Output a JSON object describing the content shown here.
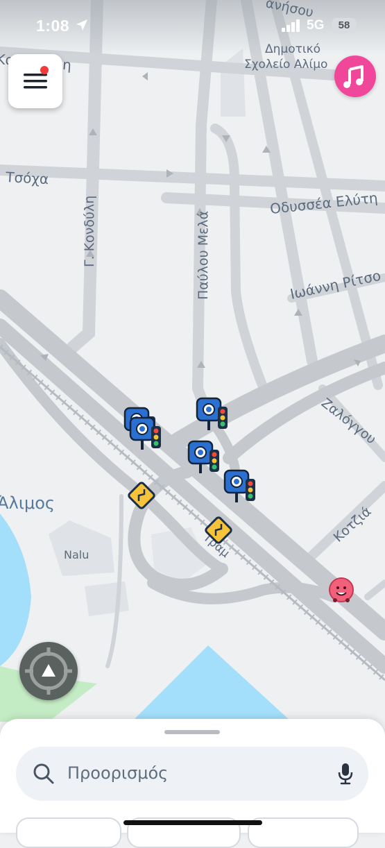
{
  "status_bar": {
    "time": "1:08",
    "network": "5G",
    "battery": "58",
    "location_icon": "location-arrow-icon",
    "signal_icon": "cellular-signal-icon"
  },
  "map": {
    "street_labels": {
      "tsocha": "Τσόχα",
      "kondyli": "Γ. Κονδύλη",
      "pavlou_mela": "Παύλου Μελά",
      "odyssea_elyti": "Οδυσσέα Ελύτη",
      "ioanni_ritsou": "Ιωάννη Ρίτσο",
      "zalongou": "Ζαλόγγου",
      "kotsia": "Κοτζιά",
      "top_left": "Κο",
      "top_left_b": "λη",
      "top_right": "ανήσου",
      "rail": "Τραμ"
    },
    "place_labels": {
      "school_line1": "Δημοτικό",
      "school_line2": "Σχολείο Αλίμο",
      "alimos": "Άλιμος",
      "nalu": "Nalu"
    },
    "markers": [
      {
        "type": "speed-camera-traffic-light",
        "icon": "speed-camera-icon"
      },
      {
        "type": "speed-camera-traffic-light",
        "icon": "speed-camera-icon"
      },
      {
        "type": "speed-camera-traffic-light",
        "icon": "speed-camera-icon"
      },
      {
        "type": "speed-camera-traffic-light",
        "icon": "speed-camera-icon"
      },
      {
        "type": "speed-camera-traffic-light",
        "icon": "speed-camera-icon"
      },
      {
        "type": "winding-road-sign",
        "icon": "winding-road-icon"
      },
      {
        "type": "winding-road-sign",
        "icon": "winding-road-icon"
      },
      {
        "type": "wazer",
        "icon": "wazer-icon"
      }
    ],
    "colors": {
      "background": "#eef0f2",
      "road": "#c9cdd2",
      "water": "#a3dffa",
      "park": "#c4ecc4",
      "label": "#5b6b7d"
    }
  },
  "buttons": {
    "menu_icon": "hamburger-menu-icon",
    "music_icon": "music-note-icon",
    "recenter_icon": "recenter-crosshair-icon"
  },
  "search": {
    "placeholder": "Προορισμός",
    "search_icon": "search-icon",
    "mic_icon": "microphone-icon"
  }
}
